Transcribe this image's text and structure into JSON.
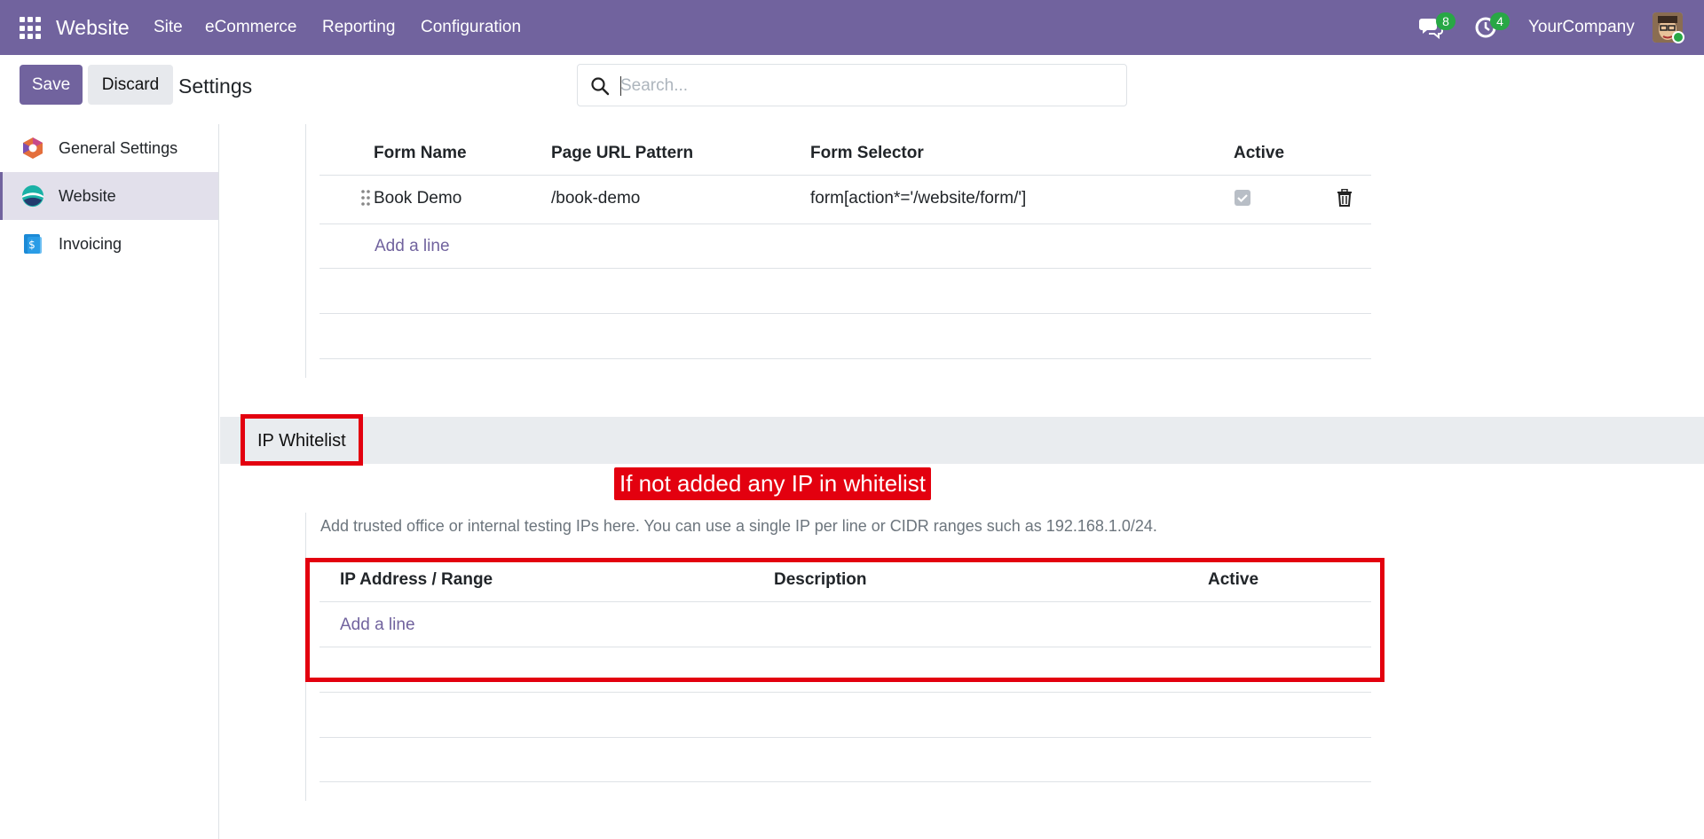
{
  "navbar": {
    "brand": "Website",
    "menu": [
      "Site",
      "eCommerce",
      "Reporting",
      "Configuration"
    ],
    "messages_count": "8",
    "activities_count": "4",
    "company": "YourCompany"
  },
  "control_panel": {
    "save_label": "Save",
    "discard_label": "Discard",
    "title": "Settings",
    "search_placeholder": "Search..."
  },
  "sidebar": {
    "items": [
      {
        "label": "General Settings",
        "icon": "general-settings-icon"
      },
      {
        "label": "Website",
        "icon": "website-app-icon",
        "active": true
      },
      {
        "label": "Invoicing",
        "icon": "invoicing-app-icon"
      }
    ]
  },
  "forms_table": {
    "headers": [
      "Form Name",
      "Page URL Pattern",
      "Form Selector",
      "Active"
    ],
    "rows": [
      {
        "form_name": "Book Demo",
        "url_pattern": "/book-demo",
        "selector": "form[action*='/website/form/']",
        "active": true
      }
    ],
    "add_line": "Add a line"
  },
  "ip_whitelist": {
    "title": "IP Whitelist",
    "annotation": "If not added any IP in whitelist",
    "help": "Add trusted office or internal testing IPs here. You can use a single IP per line or CIDR ranges such as 192.168.1.0/24.",
    "headers": [
      "IP Address / Range",
      "Description",
      "Active"
    ],
    "add_line": "Add a line"
  },
  "colors": {
    "navbar": "#71639e",
    "accent": "#71639e",
    "annotation_red": "#e3000f",
    "badge_green": "#28a745"
  }
}
